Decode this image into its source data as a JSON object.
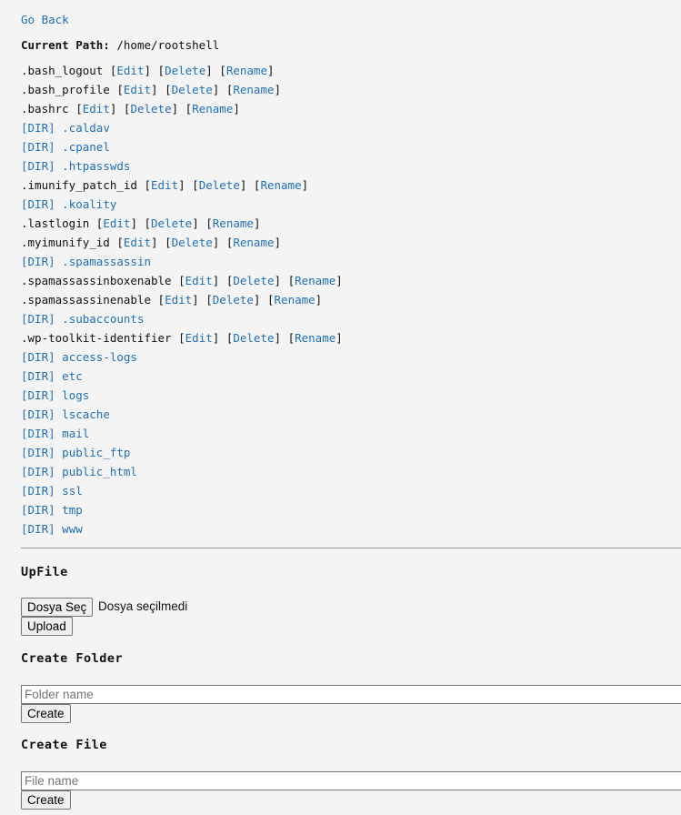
{
  "nav": {
    "go_back": "Go Back"
  },
  "path": {
    "label": "Current Path:",
    "value": "/home/rootshell"
  },
  "actions": {
    "edit": "Edit",
    "delete": "Delete",
    "rename": "Rename",
    "dir_prefix": "[DIR]"
  },
  "entries": [
    {
      "type": "file",
      "name": ".bash_logout"
    },
    {
      "type": "file",
      "name": ".bash_profile"
    },
    {
      "type": "file",
      "name": ".bashrc"
    },
    {
      "type": "dir",
      "name": ".caldav"
    },
    {
      "type": "dir",
      "name": ".cpanel"
    },
    {
      "type": "dir",
      "name": ".htpasswds"
    },
    {
      "type": "file",
      "name": ".imunify_patch_id"
    },
    {
      "type": "dir",
      "name": ".koality"
    },
    {
      "type": "file",
      "name": ".lastlogin"
    },
    {
      "type": "file",
      "name": ".myimunify_id"
    },
    {
      "type": "dir",
      "name": ".spamassassin"
    },
    {
      "type": "file",
      "name": ".spamassassinboxenable"
    },
    {
      "type": "file",
      "name": ".spamassassinenable"
    },
    {
      "type": "dir",
      "name": ".subaccounts"
    },
    {
      "type": "file",
      "name": ".wp-toolkit-identifier"
    },
    {
      "type": "dir",
      "name": "access-logs"
    },
    {
      "type": "dir",
      "name": "etc"
    },
    {
      "type": "dir",
      "name": "logs"
    },
    {
      "type": "dir",
      "name": "lscache"
    },
    {
      "type": "dir",
      "name": "mail"
    },
    {
      "type": "dir",
      "name": "public_ftp"
    },
    {
      "type": "dir",
      "name": "public_html"
    },
    {
      "type": "dir",
      "name": "ssl"
    },
    {
      "type": "dir",
      "name": "tmp"
    },
    {
      "type": "dir",
      "name": "www"
    }
  ],
  "upload": {
    "heading": "UpFile",
    "choose_label": "Dosya Seç",
    "no_file_text": "Dosya seçilmedi",
    "upload_label": "Upload"
  },
  "create_folder": {
    "heading": "Create Folder",
    "placeholder": "Folder name",
    "button_label": "Create"
  },
  "create_file": {
    "heading": "Create File",
    "placeholder": "File name",
    "button_label": "Create"
  }
}
